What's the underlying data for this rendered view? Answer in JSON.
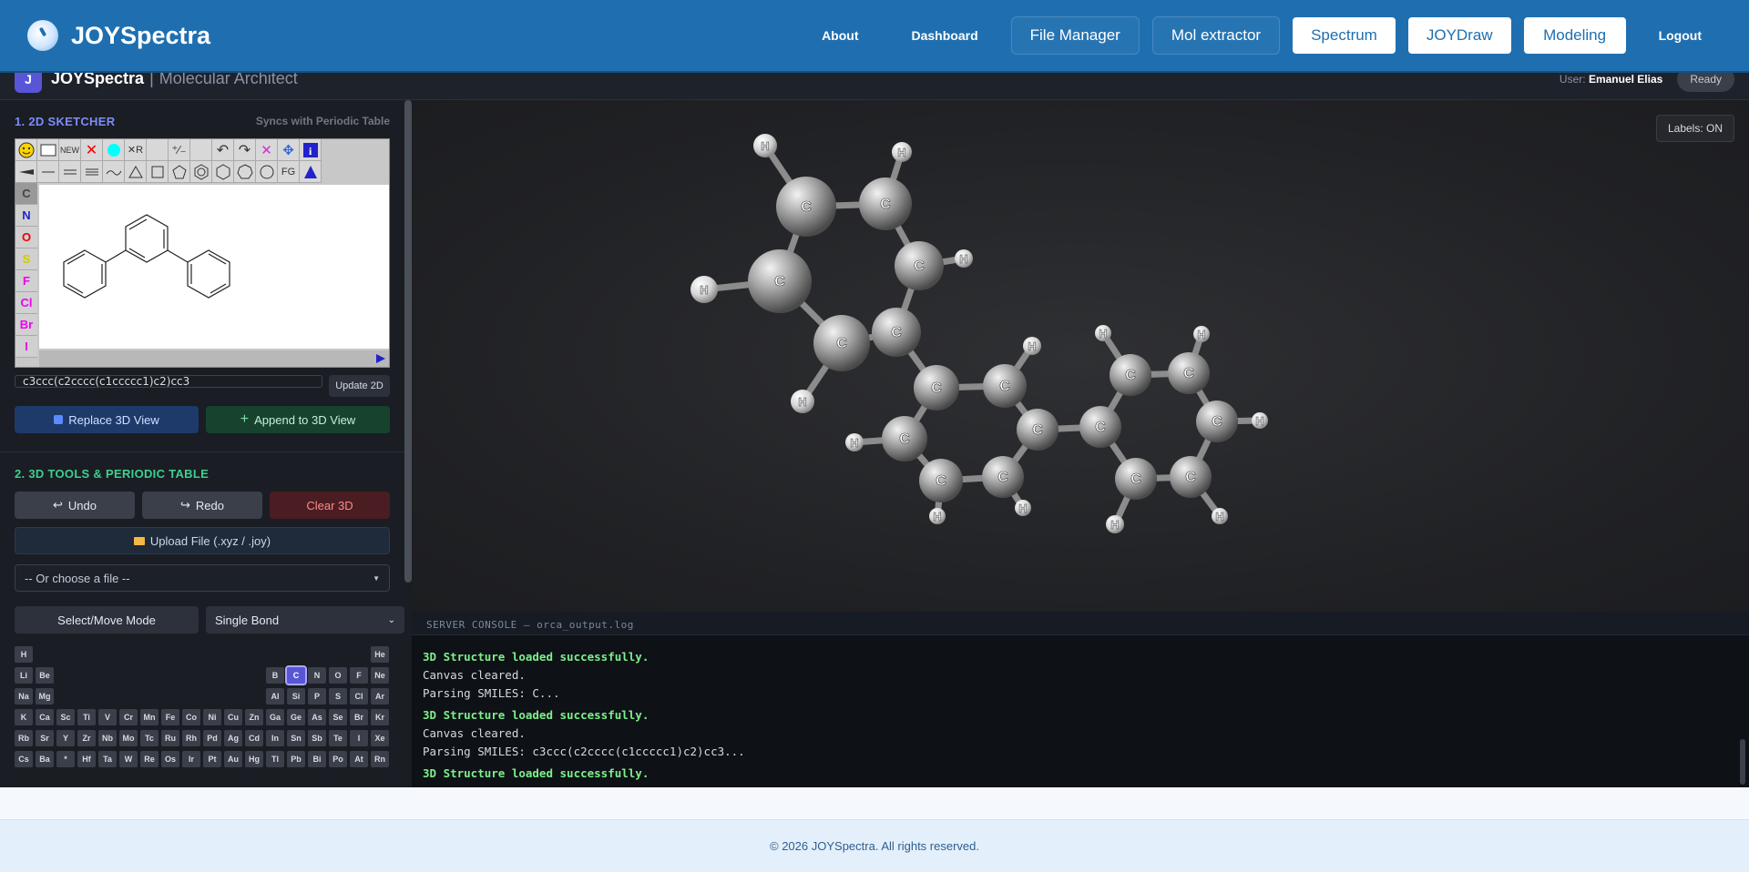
{
  "topnav": {
    "brand": "JOYSpectra",
    "links": [
      "About",
      "Dashboard"
    ],
    "ghost_buttons": [
      "File Manager",
      "Mol extractor"
    ],
    "white_buttons": [
      "Spectrum",
      "JOYDraw",
      "Modeling"
    ],
    "logout": "Logout"
  },
  "subheader": {
    "logo_letter": "J",
    "title": "JOYSpectra",
    "separator": "|",
    "subtitle": "Molecular Architect",
    "user_label": "User:",
    "user_name": "Emanuel Elias",
    "status": "Ready"
  },
  "sketcher_section": {
    "title": "1. 2D SKETCHER",
    "hint": "Syncs with Periodic Table",
    "toolbar_new": "NEW",
    "toolbar_fg": "FG",
    "elements": [
      "C",
      "N",
      "O",
      "S",
      "F",
      "Cl",
      "Br",
      "I"
    ],
    "smiles_value": "c3ccc(c2cccc(c1ccccc1)c2)cc3",
    "update_label": "Update 2D",
    "replace_label": "Replace 3D View",
    "append_label": "Append to 3D View"
  },
  "tools_section": {
    "title": "2. 3D TOOLS & PERIODIC TABLE",
    "undo": "Undo",
    "redo": "Redo",
    "clear": "Clear 3D",
    "upload": "Upload File (.xyz / .joy)",
    "file_select": "-- Or choose a file --",
    "mode_button": "Select/Move Mode",
    "bond_select": "Single Bond",
    "selected_element": "C"
  },
  "viewer": {
    "labels_toggle": "Labels: ON"
  },
  "console": {
    "header": "SERVER CONSOLE — orca_output.log",
    "lines": [
      {
        "text": "3D Structure loaded successfully.",
        "ok": true
      },
      {
        "text": "Canvas cleared.",
        "ok": false
      },
      {
        "text": "Parsing SMILES: C...",
        "ok": false
      },
      {
        "text": "3D Structure loaded successfully.",
        "ok": true
      },
      {
        "text": "Canvas cleared.",
        "ok": false
      },
      {
        "text": "Parsing SMILES: c3ccc(c2cccc(c1ccccc1)c2)cc3...",
        "ok": false
      },
      {
        "text": "3D Structure loaded successfully.",
        "ok": true
      }
    ]
  },
  "footer": {
    "copyright": "© 2026 JOYSpectra. All rights reserved."
  },
  "colors": {
    "nav_blue": "#1f6fb0",
    "accent_purple": "#7b8cff",
    "accent_green": "#3ecf8e",
    "clear_red": "#ff8a8a",
    "log_ok": "#7df08a"
  }
}
